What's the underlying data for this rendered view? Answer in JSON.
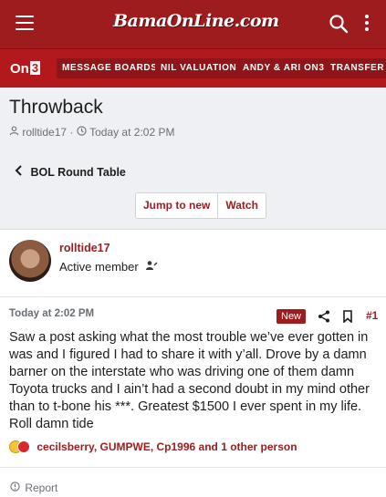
{
  "header": {
    "site_logo": "BamaOnLine.com",
    "menu_icon": "hamburger-menu-icon",
    "search_icon": "search-icon",
    "more_icon": "vertical-ellipsis-icon"
  },
  "nav": {
    "brand": "On",
    "brand_num": "3",
    "items": [
      {
        "label": "MESSAGE BOARDS"
      },
      {
        "label": "NIL VALUATION"
      },
      {
        "label": "ANDY & ARI ON3"
      },
      {
        "label": "TRANSFER PO"
      }
    ]
  },
  "thread": {
    "title": "Throwback",
    "author": "rolltide17",
    "separator": "·",
    "timestamp": "Today at 2:02 PM",
    "forum": "BOL Round Table",
    "jump_label": "Jump to new",
    "watch_label": "Watch"
  },
  "post": {
    "username": "rolltide17",
    "user_title": "Active member",
    "timestamp": "Today at 2:02 PM",
    "badge": "New",
    "number": "#1",
    "body": "Saw a post asking what the most trouble we’ve ever gotten in was and I figured I had to share it with y’all. Drove by a damn barner on the interstate who was driving one of them damn Toyota trucks and I ain’t had a second doubt in my mind other than to t-bone his ***. Greatest $1500 I ever spent in my life. Roll damn tide",
    "reactions_text": "cecilsberry, GUMPWE, Cp1996 and 1 other person",
    "report_label": "Report"
  },
  "colors": {
    "brand_red": "#9e1b1e",
    "nav_red": "#b3191c",
    "header_bg": "#eef0f3"
  }
}
